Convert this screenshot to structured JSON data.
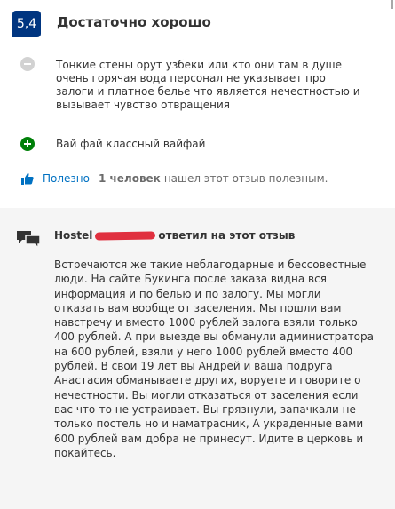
{
  "review": {
    "score": "5,4",
    "score_word": "Достаточно хорошо",
    "negative_text": "Тонкие стены орут узбеки или кто они там  в душе очень горячая вода персонал не указывает про залоги и платное белье что является нечестностью и вызывает чувство отвращения",
    "positive_text": "Вай фай классный вайфай",
    "negative_icon": "minus-circle-icon",
    "positive_icon": "plus-circle-icon"
  },
  "helpful": {
    "icon": "thumbs-up-icon",
    "button_label": "Полезно",
    "count": "1 человек",
    "rest": "нашел этот отзыв полезным."
  },
  "reply": {
    "icon": "chat-bubbles-icon",
    "hotel_prefix": "Hostel",
    "suffix": "ответил на этот отзыв",
    "text": "Встречаются же такие неблагодарные и бессовестные люди. На сайте Букинга после заказа видна вся информация и по белью и по залогу. Мы могли отказать вам вообще от заселения. Мы пошли вам навстречу и вместо 1000 рублей залога взяли только 400 рублей. А при выезде вы обманули администратора на 600 рублей, взяли у него 1000 рублей вместо 400 рублей. В свои 19 лет вы Андрей и ваша подруга Анастасия обманываете других, воруете и говорите о нечестности. Вы могли отказаться от заселения если вас что-то не устраивает. Вы грязнули, запачкали не только постель но и наматрасник, А украденные вами 600 рублей вам добра не принесут. Идите в церковь и покайтесь."
  },
  "colors": {
    "badge": "#003580",
    "positive": "#008009",
    "negative": "#d2d2d2",
    "link": "#0071c2",
    "redaction": "#e0303f",
    "reply_bg": "#f5f5f5"
  }
}
